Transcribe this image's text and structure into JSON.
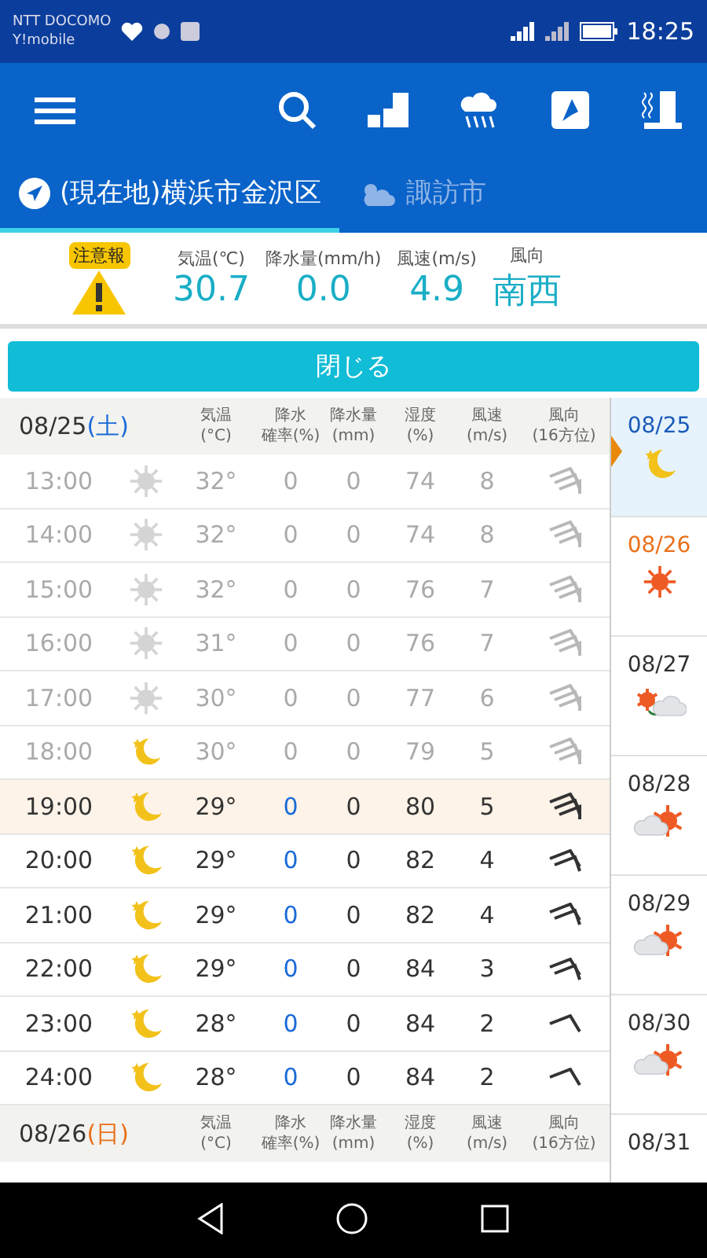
{
  "status_bar": {
    "carriers": [
      "NTT DOCOMO",
      "Y!mobile"
    ],
    "time": "18:25"
  },
  "tabs": [
    {
      "label": "(現在地)横浜市金沢区",
      "kind": "location",
      "selected": true
    },
    {
      "label": "諏訪市",
      "kind": "weather",
      "selected": false
    }
  ],
  "alert": {
    "badge": "注意報"
  },
  "current": [
    {
      "label": "気温(℃)",
      "value": "30.7"
    },
    {
      "label": "降水量(mm/h)",
      "value": "0.0"
    },
    {
      "label": "風速(m/s)",
      "value": "4.9"
    },
    {
      "label": "風向",
      "value": "南西"
    }
  ],
  "close_button": "閉じる",
  "days": [
    {
      "date": "08/25",
      "weekday": "(土)",
      "color": "#1a6ad8",
      "columns": [
        {
          "top": "気温",
          "bottom": "(°C)"
        },
        {
          "top": "降水",
          "bottom": "確率(%)"
        },
        {
          "top": "降水量",
          "bottom": "(mm)"
        },
        {
          "top": "湿度",
          "bottom": "(%)"
        },
        {
          "top": "風速",
          "bottom": "(m/s)"
        },
        {
          "top": "風向",
          "bottom": "(16方位)"
        }
      ],
      "hours": [
        {
          "time": "13:00",
          "kind": "sun",
          "temp": "32°",
          "prob": "0",
          "mm": "0",
          "humidity": "74",
          "wind": "8",
          "past": true,
          "selected": false
        },
        {
          "time": "14:00",
          "kind": "sun",
          "temp": "32°",
          "prob": "0",
          "mm": "0",
          "humidity": "74",
          "wind": "8",
          "past": true,
          "selected": false
        },
        {
          "time": "15:00",
          "kind": "sun",
          "temp": "32°",
          "prob": "0",
          "mm": "0",
          "humidity": "76",
          "wind": "7",
          "past": true,
          "selected": false
        },
        {
          "time": "16:00",
          "kind": "sun",
          "temp": "31°",
          "prob": "0",
          "mm": "0",
          "humidity": "76",
          "wind": "7",
          "past": true,
          "selected": false
        },
        {
          "time": "17:00",
          "kind": "sun",
          "temp": "30°",
          "prob": "0",
          "mm": "0",
          "humidity": "77",
          "wind": "6",
          "past": true,
          "selected": false
        },
        {
          "time": "18:00",
          "kind": "moon",
          "temp": "30°",
          "prob": "0",
          "mm": "0",
          "humidity": "79",
          "wind": "5",
          "past": true,
          "selected": false
        },
        {
          "time": "19:00",
          "kind": "moon",
          "temp": "29°",
          "prob": "0",
          "mm": "0",
          "humidity": "80",
          "wind": "5",
          "past": false,
          "selected": true
        },
        {
          "time": "20:00",
          "kind": "moon",
          "temp": "29°",
          "prob": "0",
          "mm": "0",
          "humidity": "82",
          "wind": "4",
          "past": false,
          "selected": false
        },
        {
          "time": "21:00",
          "kind": "moon",
          "temp": "29°",
          "prob": "0",
          "mm": "0",
          "humidity": "82",
          "wind": "4",
          "past": false,
          "selected": false
        },
        {
          "time": "22:00",
          "kind": "moon",
          "temp": "29°",
          "prob": "0",
          "mm": "0",
          "humidity": "84",
          "wind": "3",
          "past": false,
          "selected": false
        },
        {
          "time": "23:00",
          "kind": "moon",
          "temp": "28°",
          "prob": "0",
          "mm": "0",
          "humidity": "84",
          "wind": "2",
          "past": false,
          "selected": false
        },
        {
          "time": "24:00",
          "kind": "moon",
          "temp": "28°",
          "prob": "0",
          "mm": "0",
          "humidity": "84",
          "wind": "2",
          "past": false,
          "selected": false
        }
      ]
    },
    {
      "date": "08/26",
      "weekday": "(日)",
      "color": "#e8701a",
      "columns": [
        {
          "top": "気温",
          "bottom": "(°C)"
        },
        {
          "top": "降水",
          "bottom": "確率(%)"
        },
        {
          "top": "降水量",
          "bottom": "(mm)"
        },
        {
          "top": "湿度",
          "bottom": "(%)"
        },
        {
          "top": "風速",
          "bottom": "(m/s)"
        },
        {
          "top": "風向",
          "bottom": "(16方位)"
        }
      ]
    }
  ],
  "week": [
    {
      "date": "08/25",
      "kind": "moon",
      "color": "#1a5ab8",
      "selected": true
    },
    {
      "date": "08/26",
      "kind": "sun",
      "color": "#e8701a",
      "selected": false
    },
    {
      "date": "08/27",
      "kind": "sun_to_cloud",
      "color": "#333333",
      "selected": false
    },
    {
      "date": "08/28",
      "kind": "cloud_sun",
      "color": "#333333",
      "selected": false
    },
    {
      "date": "08/29",
      "kind": "cloud_sun",
      "color": "#333333",
      "selected": false
    },
    {
      "date": "08/30",
      "kind": "cloud_sun",
      "color": "#333333",
      "selected": false
    },
    {
      "date": "08/31",
      "color": "#333333",
      "selected": false
    }
  ]
}
